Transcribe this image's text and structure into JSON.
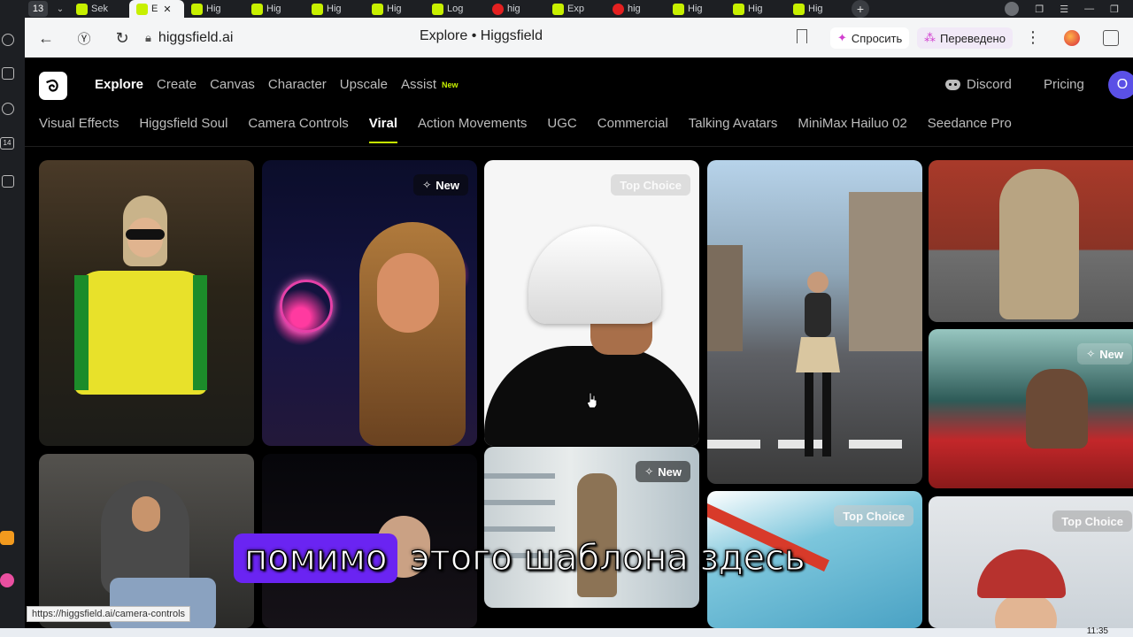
{
  "browser": {
    "tab_count": "13",
    "tabs": [
      {
        "label": "Sek",
        "favicon": "higgsfield-icon"
      },
      {
        "label": "E",
        "favicon": "higgsfield-icon",
        "active": true
      },
      {
        "label": "Hig",
        "favicon": "higgsfield-icon"
      },
      {
        "label": "Hig",
        "favicon": "higgsfield-icon"
      },
      {
        "label": "Hig",
        "favicon": "higgsfield-icon"
      },
      {
        "label": "Hig",
        "favicon": "higgsfield-icon"
      },
      {
        "label": "Log",
        "favicon": "higgsfield-icon"
      },
      {
        "label": "hig",
        "favicon": "yandex-icon"
      },
      {
        "label": "Exp",
        "favicon": "higgsfield-icon"
      },
      {
        "label": "hig",
        "favicon": "yandex-icon"
      },
      {
        "label": "Hig",
        "favicon": "higgsfield-icon"
      },
      {
        "label": "Hig",
        "favicon": "higgsfield-icon"
      },
      {
        "label": "Hig",
        "favicon": "higgsfield-icon"
      }
    ],
    "url": "higgsfield.ai",
    "page_title": "Explore • Higgsfield",
    "ask_label": "Спросить",
    "translated_label": "Переведено",
    "status_url": "https://higgsfield.ai/camera-controls",
    "sidebar_badge": "14"
  },
  "site": {
    "main_nav": [
      {
        "label": "Explore",
        "active": true
      },
      {
        "label": "Create"
      },
      {
        "label": "Canvas"
      },
      {
        "label": "Character"
      },
      {
        "label": "Upscale"
      },
      {
        "label": "Assist"
      }
    ],
    "assist_badge": "New",
    "discord_label": "Discord",
    "pricing_label": "Pricing",
    "user_initial": "O",
    "sub_nav": [
      {
        "label": "Visual Effects"
      },
      {
        "label": "Higgsfield Soul"
      },
      {
        "label": "Camera Controls"
      },
      {
        "label": "Viral",
        "active": true
      },
      {
        "label": "Action Movements"
      },
      {
        "label": "UGC"
      },
      {
        "label": "Commercial"
      },
      {
        "label": "Talking Avatars"
      },
      {
        "label": "MiniMax Hailuo 02"
      },
      {
        "label": "Seedance Pro"
      }
    ],
    "badges": {
      "new": "New",
      "top_choice": "Top Choice"
    }
  },
  "subtitle": {
    "highlight": "помимо",
    "rest": "этого шаблона здесь"
  },
  "system": {
    "clock": "11:35"
  },
  "colors": {
    "accent": "#c7f000",
    "subtitle_highlight": "#6a24f2",
    "avatar": "#5a50e6"
  }
}
